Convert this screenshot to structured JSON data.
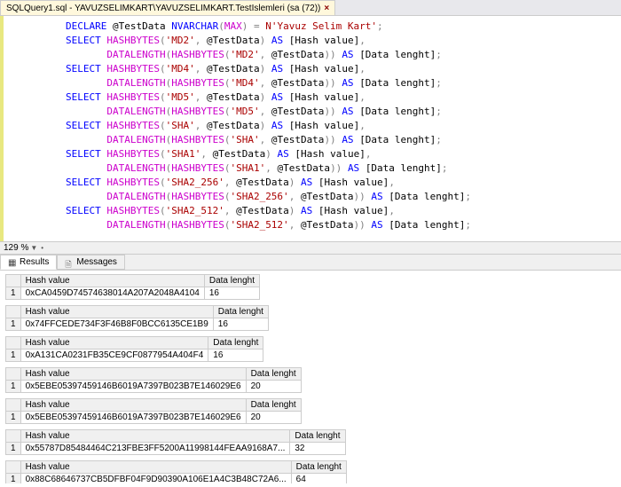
{
  "tab": {
    "title": "SQLQuery1.sql - YAVUZSELIMKART\\YAVUZSELIMKART.TestIslemleri (sa (72))"
  },
  "code": {
    "declare": "DECLARE",
    "select": "SELECT",
    "as": "AS",
    "nvarchar": "NVARCHAR",
    "max": "MAX",
    "hashbytes": "HASHBYTES",
    "datalength": "DATALENGTH",
    "var": "@TestData",
    "eq": "=",
    "nprefix": "N",
    "strval": "'Yavuz Selim Kart'",
    "hash_alias": "[Hash value]",
    "len_alias": "[Data lenght]",
    "algos": [
      "'MD2'",
      "'MD4'",
      "'MD5'",
      "'SHA'",
      "'SHA1'",
      "'SHA2_256'",
      "'SHA2_512'"
    ]
  },
  "zoom": "129 %",
  "rtabs": {
    "results": "Results",
    "messages": "Messages"
  },
  "results": [
    {
      "hash": "0xCA0459D74574638014A207A2048A4104",
      "len": "16"
    },
    {
      "hash": "0x74FFCEDE734F3F46B8F0BCC6135CE1B9",
      "len": "16"
    },
    {
      "hash": "0xA131CA0231FB35CE9CF0877954A404F4",
      "len": "16"
    },
    {
      "hash": "0x5EBE05397459146B6019A7397B023B7E146029E6",
      "len": "20"
    },
    {
      "hash": "0x5EBE05397459146B6019A7397B023B7E146029E6",
      "len": "20"
    },
    {
      "hash": "0x55787D85484464C213FBE3FF5200A11998144FEAA9168A7...",
      "len": "32"
    },
    {
      "hash": "0x88C68646737CB5DFBF04F9D90390A106E1A4C3B48C72A6...",
      "len": "64"
    }
  ],
  "headers": {
    "hash": "Hash value",
    "len": "Data lenght",
    "row": "1"
  }
}
